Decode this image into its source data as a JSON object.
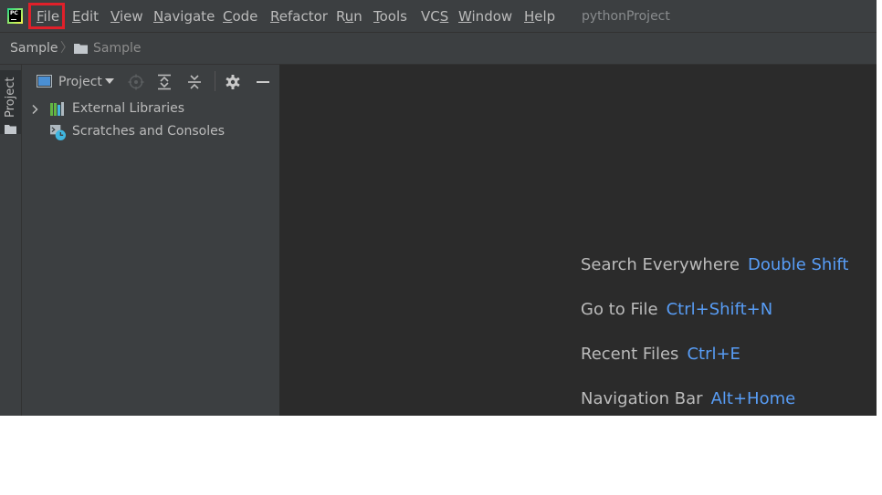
{
  "menu": {
    "app_icon_text": "PC",
    "items": [
      {
        "pre": "",
        "key": "F",
        "post": "ile"
      },
      {
        "pre": "",
        "key": "E",
        "post": "dit"
      },
      {
        "pre": "",
        "key": "V",
        "post": "iew"
      },
      {
        "pre": "",
        "key": "N",
        "post": "avigate"
      },
      {
        "pre": "",
        "key": "C",
        "post": "ode"
      },
      {
        "pre": "",
        "key": "R",
        "post": "efactor"
      },
      {
        "pre": "R",
        "key": "u",
        "post": "n"
      },
      {
        "pre": "",
        "key": "T",
        "post": "ools"
      },
      {
        "pre": "VC",
        "key": "S",
        "post": ""
      },
      {
        "pre": "",
        "key": "W",
        "post": "indow"
      },
      {
        "pre": "",
        "key": "H",
        "post": "elp"
      }
    ],
    "window_title": "pythonProject",
    "highlight_color": "#e0202a"
  },
  "navbar": {
    "crumbs": [
      "Sample",
      "Sample"
    ],
    "separator": "〉"
  },
  "toolwindow": {
    "tab_label": "Project"
  },
  "project_panel": {
    "view_label": "Project",
    "tree": [
      {
        "label": "External Libraries",
        "icon": "library-icon",
        "expandable": true
      },
      {
        "label": "Scratches and Consoles",
        "icon": "scratches-icon",
        "expandable": false
      }
    ]
  },
  "editor": {
    "hints": [
      {
        "action": "Search Everywhere",
        "shortcut": "Double Shift"
      },
      {
        "action": "Go to File",
        "shortcut": "Ctrl+Shift+N"
      },
      {
        "action": "Recent Files",
        "shortcut": "Ctrl+E"
      },
      {
        "action": "Navigation Bar",
        "shortcut": "Alt+Home"
      }
    ],
    "shortcut_color": "#589df6"
  }
}
